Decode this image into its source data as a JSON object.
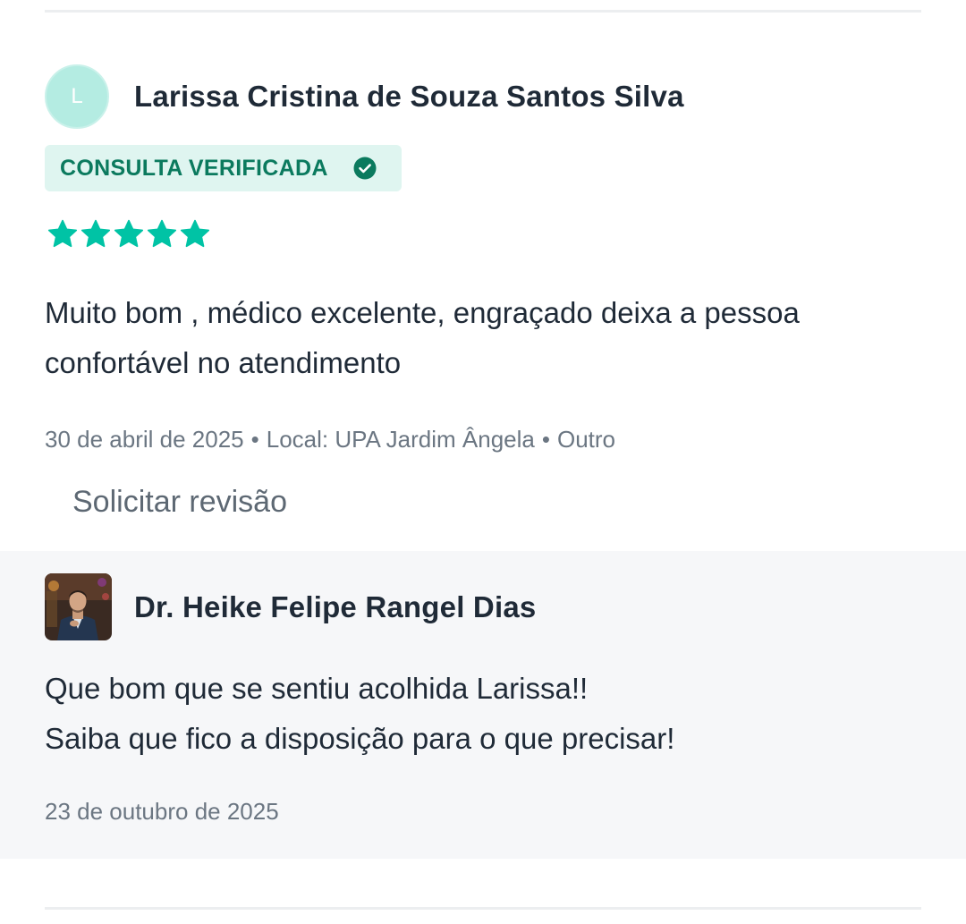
{
  "review": {
    "avatar_letter": "L",
    "author_name": "Larissa Cristina de Souza Santos Silva",
    "verified_label": "CONSULTA VERIFICADA",
    "rating": 5,
    "rating_max": 5,
    "text": "Muito bom , médico excelente, engraçado deixa a pessoa confortável no atendimento",
    "date": "30 de abril de 2025",
    "separator": "•",
    "location": "Local: UPA Jardim Ângela",
    "service": "Outro",
    "request_review_label": "Solicitar revisão"
  },
  "reply": {
    "doctor_name": "Dr. Heike Felipe Rangel Dias",
    "line1": "Que bom que se sentiu acolhida Larissa!!",
    "line2": "Saiba que fico a disposição para o que precisar!",
    "date": "23 de outubro de 2025"
  },
  "colors": {
    "accent_green": "#0b7a5e",
    "star_color": "#00c3a5",
    "badge_bg": "#dff5f0",
    "avatar_bg": "#b4ece2",
    "reply_bg": "#f6f7f9",
    "muted_text": "#6b7682"
  },
  "icons": {
    "verified": "check-circle-icon",
    "rating": "star-icon"
  }
}
